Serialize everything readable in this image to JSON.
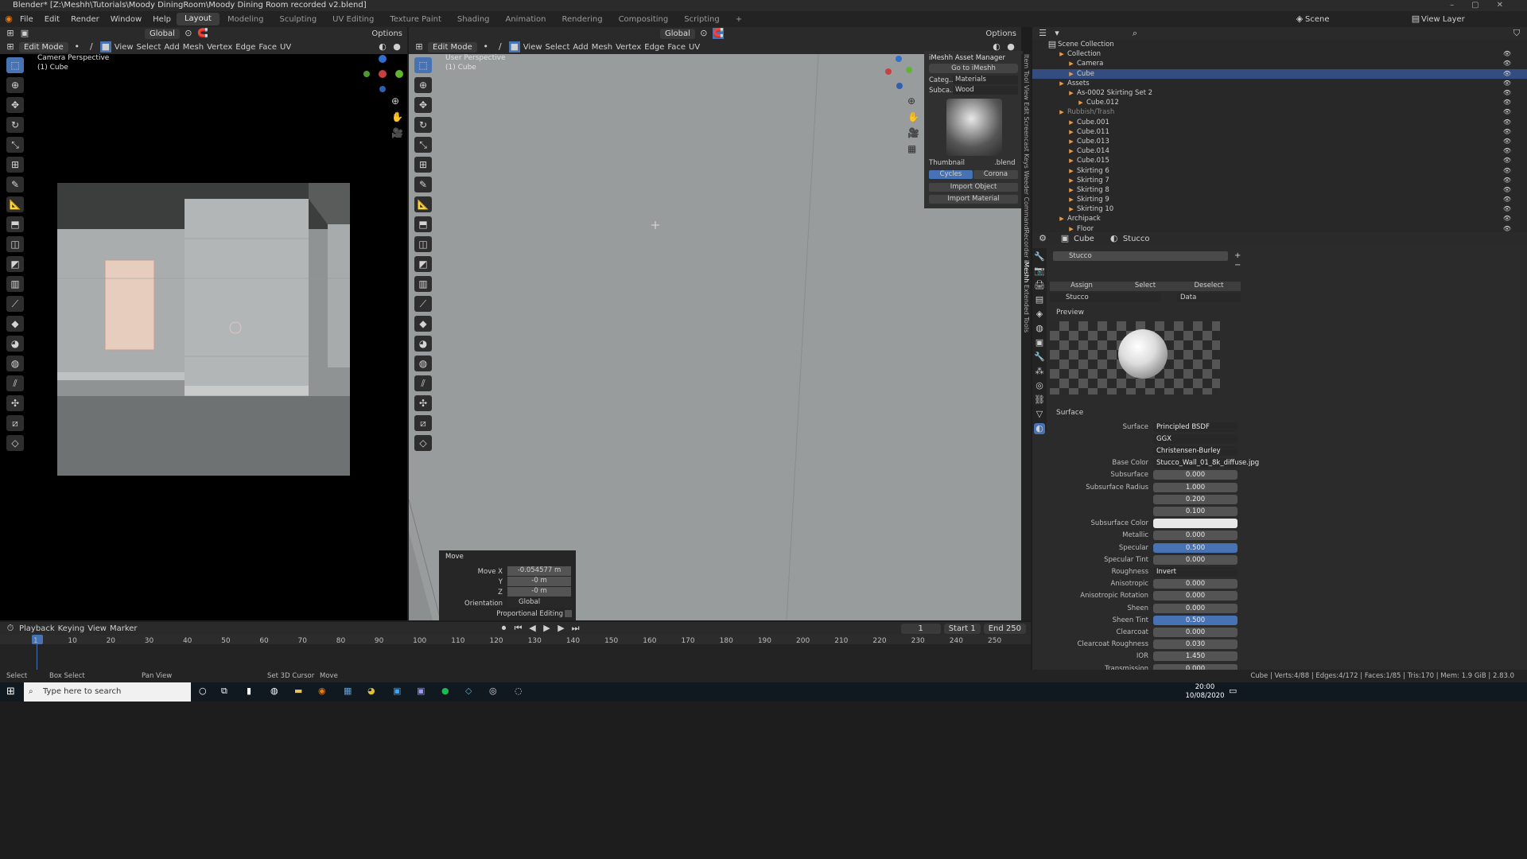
{
  "window": {
    "title": "Blender* [Z:\\Meshh\\Tutorials\\Moody DiningRoom\\Moody Dining Room recorded v2.blend]"
  },
  "menu": {
    "items": [
      "File",
      "Edit",
      "Render",
      "Window",
      "Help"
    ]
  },
  "workspaces": [
    "Layout",
    "Modeling",
    "Sculpting",
    "UV Editing",
    "Texture Paint",
    "Shading",
    "Animation",
    "Rendering",
    "Compositing",
    "Scripting"
  ],
  "top_right": {
    "scene": "Scene",
    "view_layer": "View Layer"
  },
  "left_viewport": {
    "mode": "Edit Mode",
    "menus": [
      "View",
      "Select",
      "Add",
      "Mesh",
      "Vertex",
      "Edge",
      "Face",
      "UV"
    ],
    "orientation": "Global",
    "options": "Options",
    "title": "Camera Perspective",
    "object": "(1) Cube"
  },
  "right_viewport": {
    "mode": "Edit Mode",
    "menus": [
      "View",
      "Select",
      "Add",
      "Mesh",
      "Vertex",
      "Edge",
      "Face",
      "UV"
    ],
    "orientation": "Global",
    "options": "Options",
    "title": "User Perspective",
    "object": "(1) Cube"
  },
  "imeshh": {
    "title": "iMeshh Asset Manager",
    "goto": "Go to iMeshh",
    "category_label": "Categ...",
    "category_value": "Materials",
    "subcat_label": "Subca...",
    "subcat_value": "Wood",
    "thumbnail": "Thumbnail",
    "blend": ".blend",
    "cycles": "Cycles",
    "corona": "Corona",
    "import_object": "Import Object",
    "import_material": "Import Material"
  },
  "side_tabs": [
    "Item",
    "Tool",
    "View",
    "Edit",
    "Screencast Keys",
    "Weeder",
    "CommandRecorder",
    "iMeshh",
    "Extended Tools"
  ],
  "move_panel": {
    "title": "Move",
    "x_label": "Move X",
    "x_value": "-0.054577 m",
    "y_label": "Y",
    "y_value": "-0 m",
    "z_label": "Z",
    "z_value": "-0 m",
    "orientation_label": "Orientation",
    "orientation_value": "Global",
    "proportional": "Proportional Editing"
  },
  "outliner": {
    "root": "Scene Collection",
    "rows": [
      {
        "label": "Collection",
        "indent": 1
      },
      {
        "label": "Camera",
        "indent": 2
      },
      {
        "label": "Cube",
        "indent": 2,
        "selected": true
      },
      {
        "label": "Assets",
        "indent": 1
      },
      {
        "label": "As-0002 Skirting Set 2",
        "indent": 2
      },
      {
        "label": "Cube.012",
        "indent": 3
      },
      {
        "label": "Rubbish/Trash",
        "indent": 1,
        "dim": true
      },
      {
        "label": "Cube.001",
        "indent": 2
      },
      {
        "label": "Cube.011",
        "indent": 2
      },
      {
        "label": "Cube.013",
        "indent": 2
      },
      {
        "label": "Cube.014",
        "indent": 2
      },
      {
        "label": "Cube.015",
        "indent": 2
      },
      {
        "label": "Skirting 6",
        "indent": 2
      },
      {
        "label": "Skirting 7",
        "indent": 2
      },
      {
        "label": "Skirting 8",
        "indent": 2
      },
      {
        "label": "Skirting 9",
        "indent": 2
      },
      {
        "label": "Skirting 10",
        "indent": 2
      },
      {
        "label": "Archipack",
        "indent": 1
      },
      {
        "label": "Floor",
        "indent": 2
      }
    ]
  },
  "properties": {
    "object": "Cube",
    "material": "Stucco",
    "slot": "Stucco",
    "assign": "Assign",
    "select": "Select",
    "deselect": "Deselect",
    "mat_name": "Stucco",
    "data": "Data",
    "preview": "Preview",
    "surface_section": "Surface",
    "rows": [
      {
        "label": "Surface",
        "value": "Principled BSDF",
        "style": "dark"
      },
      {
        "label": "",
        "value": "GGX",
        "style": "dark"
      },
      {
        "label": "",
        "value": "Christensen-Burley",
        "style": "dark"
      },
      {
        "label": "Base Color",
        "value": "Stucco_Wall_01_8k_diffuse.jpg",
        "style": "dark"
      },
      {
        "label": "Subsurface",
        "value": "0.000",
        "style": ""
      },
      {
        "label": "Subsurface Radius",
        "value": "1.000",
        "style": ""
      },
      {
        "label": "",
        "value": "0.200",
        "style": ""
      },
      {
        "label": "",
        "value": "0.100",
        "style": ""
      },
      {
        "label": "Subsurface Color",
        "value": "",
        "style": "white"
      },
      {
        "label": "Metallic",
        "value": "0.000",
        "style": ""
      },
      {
        "label": "Specular",
        "value": "0.500",
        "style": "blue"
      },
      {
        "label": "Specular Tint",
        "value": "0.000",
        "style": ""
      },
      {
        "label": "Roughness",
        "value": "Invert",
        "style": "dark"
      },
      {
        "label": "Anisotropic",
        "value": "0.000",
        "style": ""
      },
      {
        "label": "Anisotropic Rotation",
        "value": "0.000",
        "style": ""
      },
      {
        "label": "Sheen",
        "value": "0.000",
        "style": ""
      },
      {
        "label": "Sheen Tint",
        "value": "0.500",
        "style": "blue"
      },
      {
        "label": "Clearcoat",
        "value": "0.000",
        "style": ""
      },
      {
        "label": "Clearcoat Roughness",
        "value": "0.030",
        "style": ""
      },
      {
        "label": "IOR",
        "value": "1.450",
        "style": ""
      },
      {
        "label": "Transmission",
        "value": "0.000",
        "style": ""
      }
    ]
  },
  "timeline": {
    "menus": [
      "Playback",
      "Keying",
      "View",
      "Marker"
    ],
    "current_frame": "1",
    "start_label": "Start",
    "start": "1",
    "end_label": "End",
    "end": "250",
    "ticks": [
      "1",
      "10",
      "20",
      "30",
      "40",
      "50",
      "60",
      "70",
      "80",
      "90",
      "100",
      "110",
      "120",
      "130",
      "140",
      "150",
      "160",
      "170",
      "180",
      "190",
      "200",
      "210",
      "220",
      "230",
      "240",
      "250"
    ]
  },
  "statusbar": {
    "select": "Select",
    "box_select": "Box Select",
    "pan_view": "Pan View",
    "set_cursor": "Set 3D Cursor",
    "move": "Move",
    "stats": "Cube | Verts:4/88 | Edges:4/172 | Faces:1/85 | Tris:170 | Mem: 1.9 GiB | 2.83.0"
  },
  "taskbar": {
    "search": "Type here to search",
    "time": "20:00",
    "date": "10/08/2020"
  }
}
